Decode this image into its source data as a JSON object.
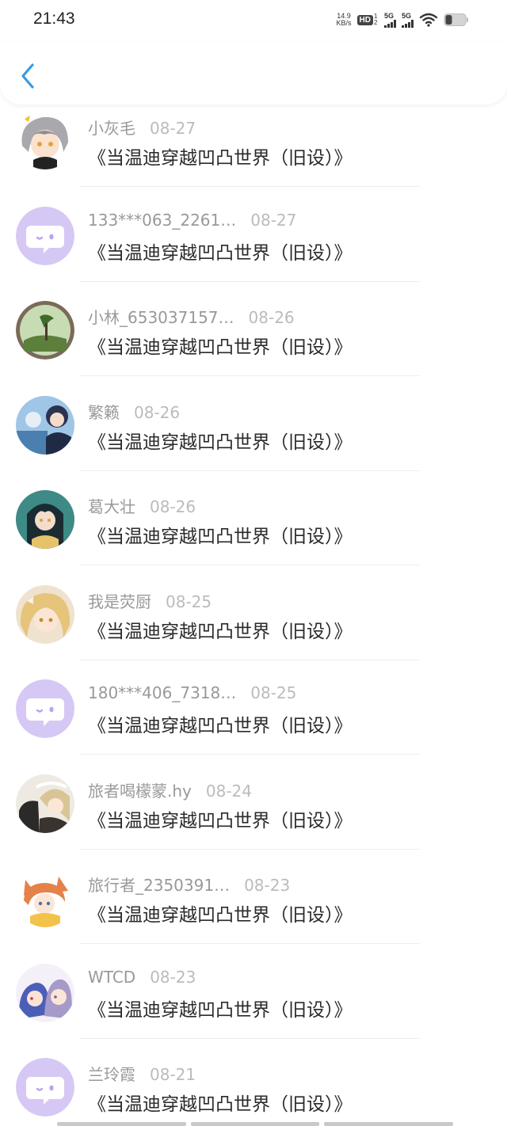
{
  "status_bar": {
    "time": "21:43",
    "net_speed_value": "14.9",
    "net_speed_unit": "KB/s",
    "hd_label": "HD",
    "hd_sub": "1 2",
    "sim1": "5G",
    "sim2": "5G"
  },
  "nav": {
    "back_icon": "chevron-left-icon",
    "accent": "#3a9ae3"
  },
  "comments": [
    {
      "user": "小灰毛",
      "date": "08-27",
      "title": "《当温迪穿越凹凸世界（旧设）》",
      "avatar": "anime-gray-hair"
    },
    {
      "user": "133***063_2261…",
      "date": "08-27",
      "title": "《当温迪穿越凹凸世界（旧设）》",
      "avatar": "default"
    },
    {
      "user": "小林_653037157…",
      "date": "08-26",
      "title": "《当温迪穿越凹凸世界（旧设）》",
      "avatar": "landscape"
    },
    {
      "user": "繁籁",
      "date": "08-26",
      "title": "《当温迪穿越凹凸世界（旧设）》",
      "avatar": "anime-blue"
    },
    {
      "user": "葛大壮",
      "date": "08-26",
      "title": "《当温迪穿越凹凸世界（旧设）》",
      "avatar": "anime-teal"
    },
    {
      "user": "我是荧厨",
      "date": "08-25",
      "title": "《当温迪穿越凹凸世界（旧设）》",
      "avatar": "anime-blonde"
    },
    {
      "user": "180***406_7318…",
      "date": "08-25",
      "title": "《当温迪穿越凹凸世界（旧设）》",
      "avatar": "default"
    },
    {
      "user": "旅者喝檬蒙.hy",
      "date": "08-24",
      "title": "《当温迪穿越凹凸世界（旧设）》",
      "avatar": "anime-dark"
    },
    {
      "user": "旅行者_2350391…",
      "date": "08-23",
      "title": "《当温迪穿越凹凸世界（旧设）》",
      "avatar": "anime-fox"
    },
    {
      "user": "WTCD",
      "date": "08-23",
      "title": "《当温迪穿越凹凸世界（旧设）》",
      "avatar": "anime-purple"
    },
    {
      "user": "兰玲霞",
      "date": "08-21",
      "title": "《当温迪穿越凹凸世界（旧设）》",
      "avatar": "default"
    }
  ]
}
